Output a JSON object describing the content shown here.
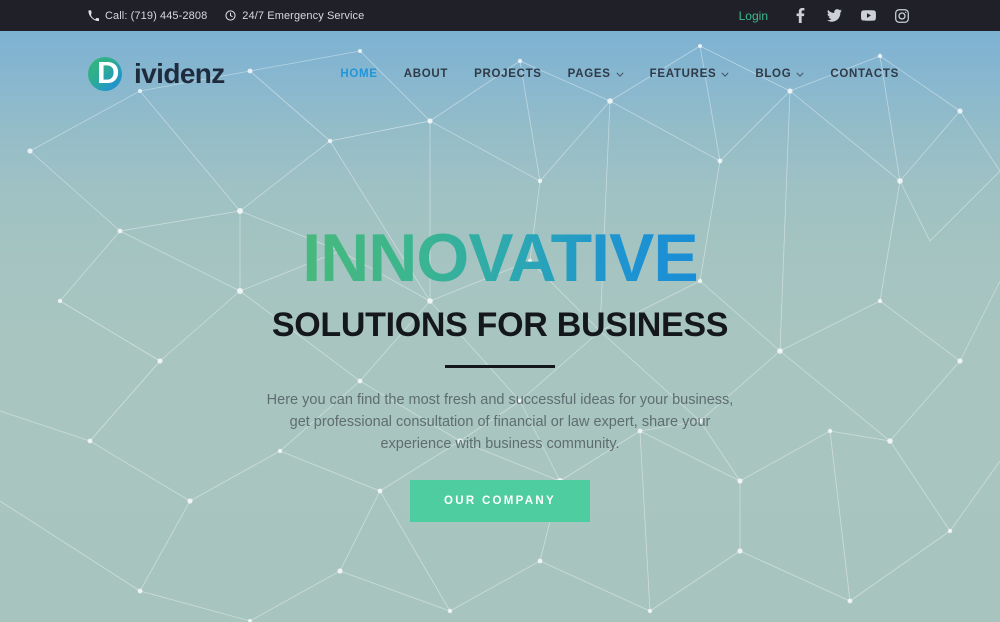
{
  "topbar": {
    "phone_icon": "phone-icon",
    "phone_text": "Call: (719) 445-2808",
    "clock_icon": "clock-icon",
    "hours_text": "24/7 Emergency Service",
    "login_label": "Login",
    "social": [
      {
        "name": "facebook-icon",
        "label": "Facebook"
      },
      {
        "name": "twitter-icon",
        "label": "Twitter"
      },
      {
        "name": "youtube-icon",
        "label": "YouTube"
      },
      {
        "name": "instagram-icon",
        "label": "Instagram"
      }
    ]
  },
  "header": {
    "logo_initial": "D",
    "logo_rest": "ividenz",
    "nav": [
      {
        "label": "HOME",
        "active": true,
        "caret": false
      },
      {
        "label": "ABOUT",
        "active": false,
        "caret": false
      },
      {
        "label": "PROJECTS",
        "active": false,
        "caret": false
      },
      {
        "label": "PAGES",
        "active": false,
        "caret": true
      },
      {
        "label": "FEATURES",
        "active": false,
        "caret": true
      },
      {
        "label": "BLOG",
        "active": false,
        "caret": true
      },
      {
        "label": "CONTACTS",
        "active": false,
        "caret": false
      }
    ]
  },
  "hero": {
    "headline": "INNOVATIVE",
    "subheadline": "SOLUTIONS FOR BUSINESS",
    "paragraph": "Here you can find the most fresh and successful ideas for your business, get professional consultation of financial or law expert, share your experience with business community.",
    "cta_label": "OUR COMPANY"
  },
  "colors": {
    "topbar_bg": "#1f2028",
    "login_green": "#3ebb8f",
    "nav_active_blue": "#2196d8",
    "headline_gradient_start": "#48b97c",
    "headline_gradient_end": "#1a8dd6",
    "cta_bg": "#4ecda0",
    "hero_top": "#7db2d2",
    "hero_bottom": "#a8c4be",
    "subhead_dark": "#14181d"
  }
}
